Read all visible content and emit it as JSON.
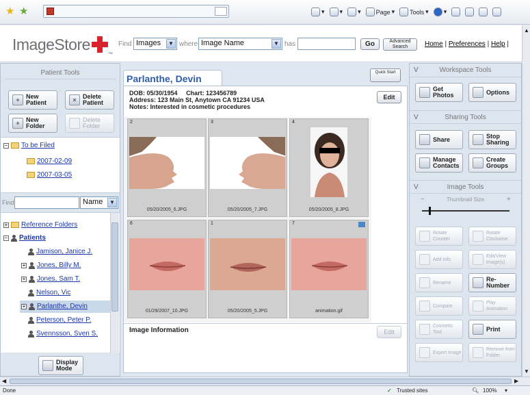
{
  "browser": {
    "toolbar": {
      "page_label": "Page",
      "tools_label": "Tools"
    }
  },
  "header": {
    "logo_text": "ImageStore",
    "find_label": "Find",
    "find_type": "Images",
    "where_label": "where",
    "where_field": "Image Name",
    "has_label": "has",
    "search_value": "",
    "go_label": "Go",
    "advanced_label_1": "Advanced",
    "advanced_label_2": "Search",
    "links": {
      "home": "Home",
      "preferences": "Preferences",
      "help": "Help",
      "sep": "|"
    }
  },
  "left": {
    "title": "Patient Tools",
    "new_patient": "New Patient",
    "delete_patient": "Delete Patient",
    "new_folder": "New Folder",
    "delete_folder": "Delete Folder",
    "to_be_filed": "To be Filed",
    "folders": [
      "2007-02-09",
      "2007-03-05"
    ],
    "find_label": "Find",
    "find_value": "",
    "find_field": "Name",
    "tree": {
      "reference": "Reference Folders",
      "patients": "Patients",
      "items": [
        "Jamison, Janice J.",
        "Jones, Billy M.",
        "Jones, Sam T.",
        "Nelson, Vic",
        "Parlanthe, Devin",
        "Peterson, Peter P.",
        "Svennsson, Sven S."
      ]
    },
    "display_mode": "Display Mode"
  },
  "main": {
    "tab_title": "Parlanthe, Devin",
    "quick_start": "Quick Start",
    "dob": "DOB: 05/30/1954",
    "chart": "Chart: 123456789",
    "address": "Address: 123 Main St, Anytown CA 91234 USA",
    "notes": "Notes: Interested in cosmetic procedures",
    "edit": "Edit",
    "thumbnails": [
      {
        "num": "2",
        "caption": "05/20/2005_6.JPG"
      },
      {
        "num": "3",
        "caption": "05/20/2005_7.JPG"
      },
      {
        "num": "4",
        "caption": "05/20/2005_8.JPG"
      },
      {
        "num": "6",
        "caption": "01/29/2007_10.JPG"
      },
      {
        "num": "1",
        "caption": "05/20/2005_5.JPG"
      },
      {
        "num": "7",
        "caption": "animation.gif"
      }
    ],
    "image_info_title": "Image Information",
    "image_info_edit": "Edit"
  },
  "right": {
    "workspace_title": "Workspace Tools",
    "get_photos": "Get Photos",
    "options": "Options",
    "sharing_title": "Sharing Tools",
    "share": "Share",
    "stop_sharing": "Stop Sharing",
    "manage_contacts": "Manage Contacts",
    "create_groups": "Create Groups",
    "image_title": "Image Tools",
    "thumb_size_label": "Thumbnail Size",
    "thumb_size_min": "−",
    "thumb_size_max": "+",
    "thumbnail_size_level": 0.08,
    "tools": [
      {
        "label": "Rotate Counter",
        "enabled": false
      },
      {
        "label": "Rotate Clockwise",
        "enabled": false
      },
      {
        "label": "Add Info",
        "enabled": false
      },
      {
        "label": "Edit/View Image(s)",
        "enabled": false
      },
      {
        "label": "Rename",
        "enabled": false
      },
      {
        "label": "Re-Number",
        "enabled": true
      },
      {
        "label": "Compare",
        "enabled": false
      },
      {
        "label": "Play Animation",
        "enabled": false
      },
      {
        "label": "Cosmetic Tool",
        "enabled": false
      },
      {
        "label": "Print",
        "enabled": true
      },
      {
        "label": "Export Image",
        "enabled": false
      },
      {
        "label": "Remove from Folder",
        "enabled": false
      }
    ]
  },
  "status": {
    "left": "Done",
    "zone": "Trusted sites",
    "zoom": "100%"
  },
  "colors": {
    "accent": "#d8232a",
    "link": "#1a36a8",
    "panel": "#dde5ef",
    "selected_row": "#c9d7ea"
  }
}
